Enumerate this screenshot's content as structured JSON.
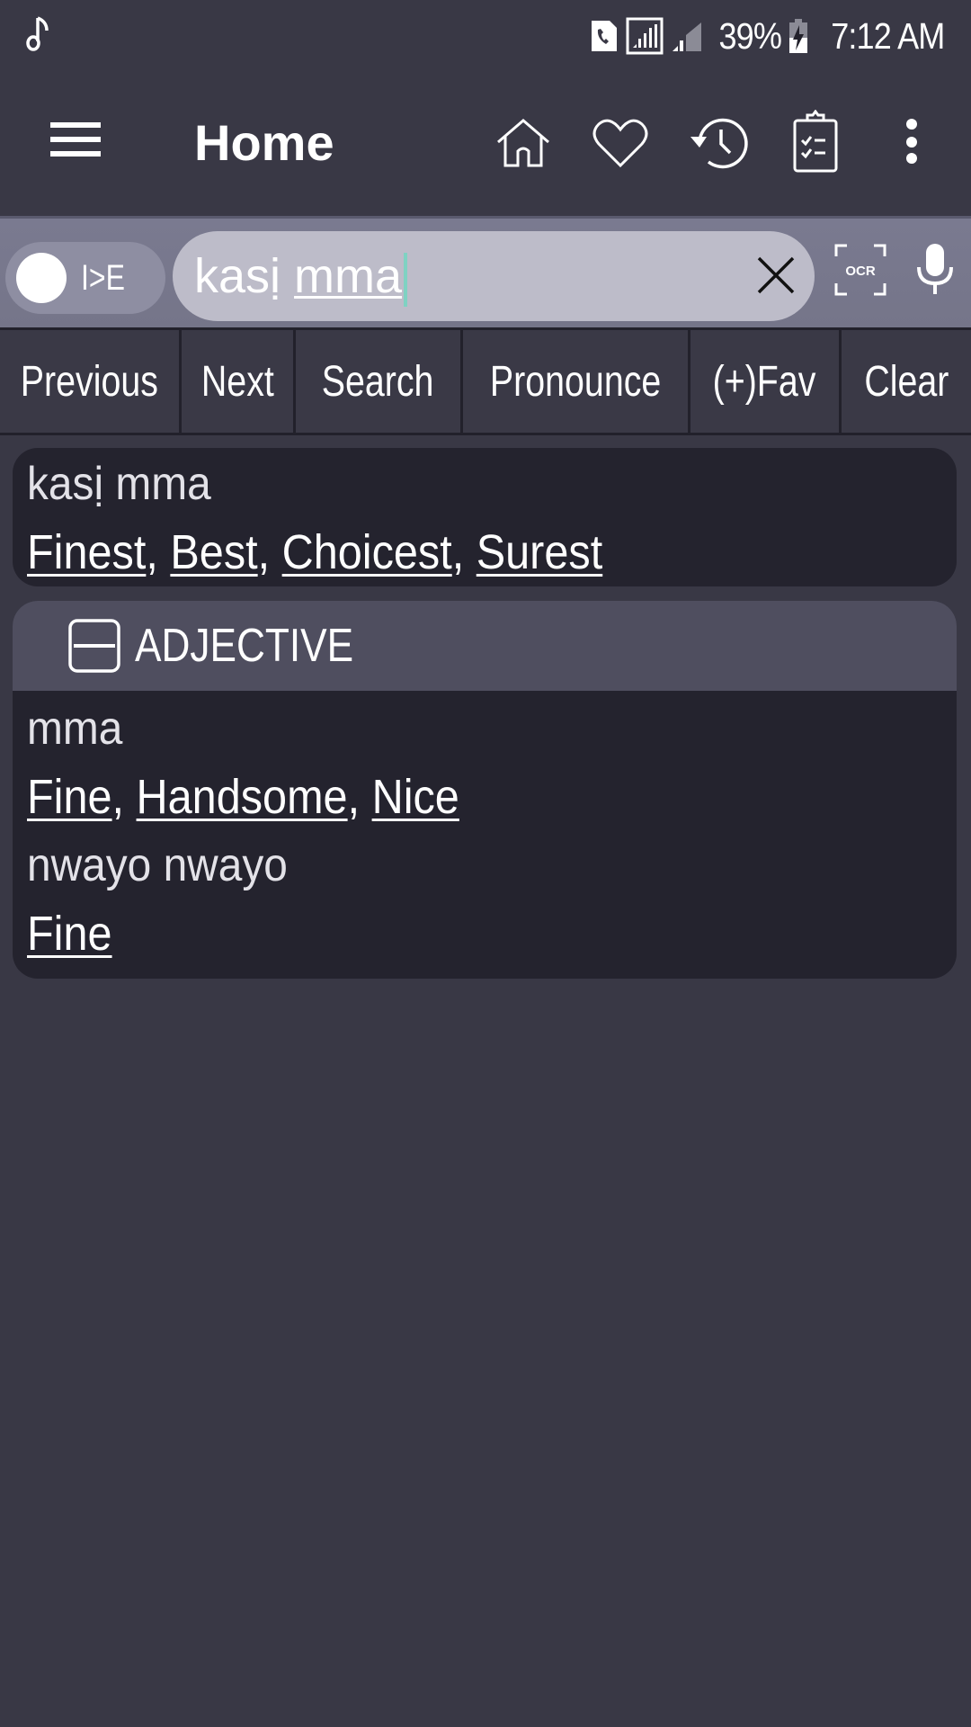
{
  "status_bar": {
    "battery": "39%",
    "time": "7:12 AM",
    "icons": [
      "music-note-icon",
      "call-sim-icon",
      "signal-boxed-icon",
      "signal-icon",
      "battery-charging-icon"
    ]
  },
  "app_bar": {
    "title": "Home",
    "actions": [
      "home-icon",
      "heart-icon",
      "history-icon",
      "clipboard-check-icon",
      "more-vert-icon"
    ]
  },
  "search": {
    "toggle_label": "I>E",
    "query_plain": "kasị ",
    "query_underlined": "mma",
    "clear_icon": "close-icon",
    "ocr_label": "OCR",
    "mic_icon": "mic-icon"
  },
  "toolbar": {
    "buttons": [
      {
        "label": "Previous"
      },
      {
        "label": "Next"
      },
      {
        "label": "Search"
      },
      {
        "label": "Pronounce"
      },
      {
        "label": "(+)Fav"
      },
      {
        "label": "Clear"
      }
    ]
  },
  "results": {
    "main_entry": {
      "word": "kasị mma",
      "translations": [
        "Finest",
        "Best",
        "Choicest",
        "Surest"
      ]
    },
    "sections": [
      {
        "part_of_speech": "ADJECTIVE",
        "expanded": true,
        "entries": [
          {
            "word": "mma",
            "translations": [
              "Fine",
              "Handsome",
              "Nice"
            ]
          },
          {
            "word": "nwayo nwayo",
            "translations": [
              "Fine"
            ]
          }
        ]
      }
    ]
  },
  "colors": {
    "background": "#393845",
    "card": "#24232e",
    "section_header": "#4f4e5f",
    "search_field": "#bdbcc9",
    "caret": "#7fd2c2"
  }
}
